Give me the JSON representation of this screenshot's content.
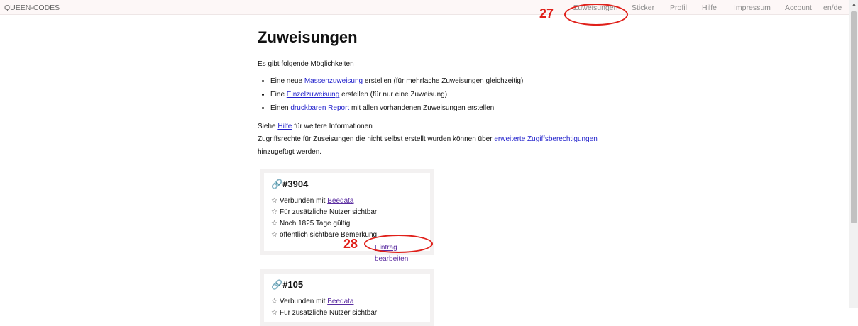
{
  "topbar": {
    "brand": "QUEEN-CODES",
    "nav": [
      "Zuweisungen",
      "Sticker",
      "Profil",
      "Hilfe",
      "Impressum",
      "Account",
      "en/de"
    ]
  },
  "annotations": {
    "a27": "27",
    "a28": "28",
    "color": "#e0201a"
  },
  "page": {
    "title": "Zuweisungen",
    "intro": "Es gibt folgende Möglichkeiten",
    "options": [
      {
        "pre": "Eine neue ",
        "link": "Massenzuweisung",
        "post": " erstellen (für mehrfache Zuweisungen gleichzeitig)"
      },
      {
        "pre": "Eine ",
        "link": "Einzelzuweisung",
        "post": " erstellen (für nur eine Zuweisung)"
      },
      {
        "pre": "Einen ",
        "link": "druckbaren Report",
        "post": " mit allen vorhandenen Zuweisungen erstellen"
      }
    ],
    "help_pre": "Siehe ",
    "help_link": "Hilfe",
    "help_post": " für weitere Informationen",
    "rights_pre": "Zugriffsrechte für Zuseisungen die nicht selbst erstellt wurden können über ",
    "rights_link": "erweiterte Zugiffsberechtigungen",
    "rights_post": "hinzugefügt werden."
  },
  "cards": [
    {
      "id": "#3904",
      "link_icon": "chain-link-icon",
      "connected_pre": "Verbunden mit ",
      "connected_link": "Beedata",
      "visible": "Für zusätzliche Nutzer sichtbar",
      "validity": "Noch 1825 Tage gültig",
      "remark": "öffentlich sichtbare Bemerkung",
      "edit": "Eintrag bearbeiten"
    },
    {
      "id": "#105",
      "link_icon": "chain-link-icon",
      "connected_pre": "Verbunden mit ",
      "connected_link": "Beedata",
      "visible": "Für zusätzliche Nutzer sichtbar"
    }
  ]
}
